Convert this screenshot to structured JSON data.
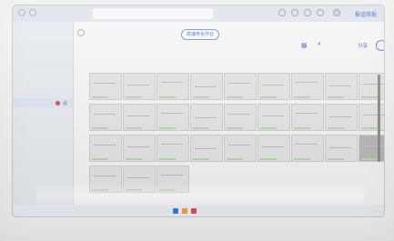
{
  "browser": {
    "active_tab": "",
    "right_link": "报道简报"
  },
  "sidebar": {
    "items": [
      {
        "label": ""
      },
      {
        "label": ""
      },
      {
        "label": ""
      },
      {
        "label": ""
      },
      {
        "label": ""
      }
    ]
  },
  "main": {
    "title_pill": "高速传化作业",
    "filters": [
      ""
    ],
    "toolbar": {
      "count_label": "4",
      "share_label": "分享"
    }
  },
  "colors": {
    "accent": "#4a6ad0",
    "alert": "#d34a4a",
    "screen_bg": "#f2f2f2",
    "sidebar_bg": "#e9ecf2"
  }
}
